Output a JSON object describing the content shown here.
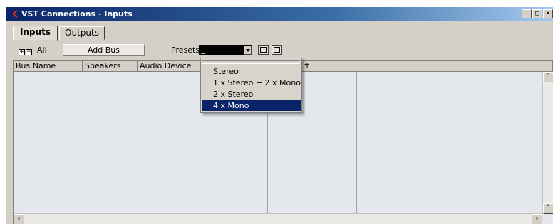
{
  "window": {
    "title": "VST Connections - Inputs",
    "controls": {
      "minimize": "_",
      "maximize": "□",
      "close": "×"
    }
  },
  "tabs": [
    {
      "label": "Inputs",
      "active": true
    },
    {
      "label": "Outputs",
      "active": false
    }
  ],
  "toolbar": {
    "expand_all_label": "All",
    "add_bus_label": "Add Bus",
    "presets_label": "Presets",
    "presets_value": "_"
  },
  "table": {
    "columns": [
      "Bus Name",
      "Speakers",
      "Audio Device",
      "",
      "rt",
      ""
    ]
  },
  "presets_dropdown": {
    "items": [
      "Stereo",
      "1 x Stereo + 2 x Mono",
      "2 x Stereo",
      "4 x Mono"
    ],
    "selected": "4 x Mono"
  },
  "colors": {
    "title_gradient_start": "#0a246a",
    "title_gradient_end": "#a6caf0",
    "selection": "#0a246a",
    "grid_background": "#e4e8ec"
  },
  "icons": [
    "cubase-logo-icon",
    "expand-all-icon",
    "collapse-all-icon",
    "store-preset-icon",
    "remove-preset-icon",
    "scroll-up-icon",
    "scroll-down-icon",
    "scroll-left-icon",
    "scroll-right-icon"
  ]
}
